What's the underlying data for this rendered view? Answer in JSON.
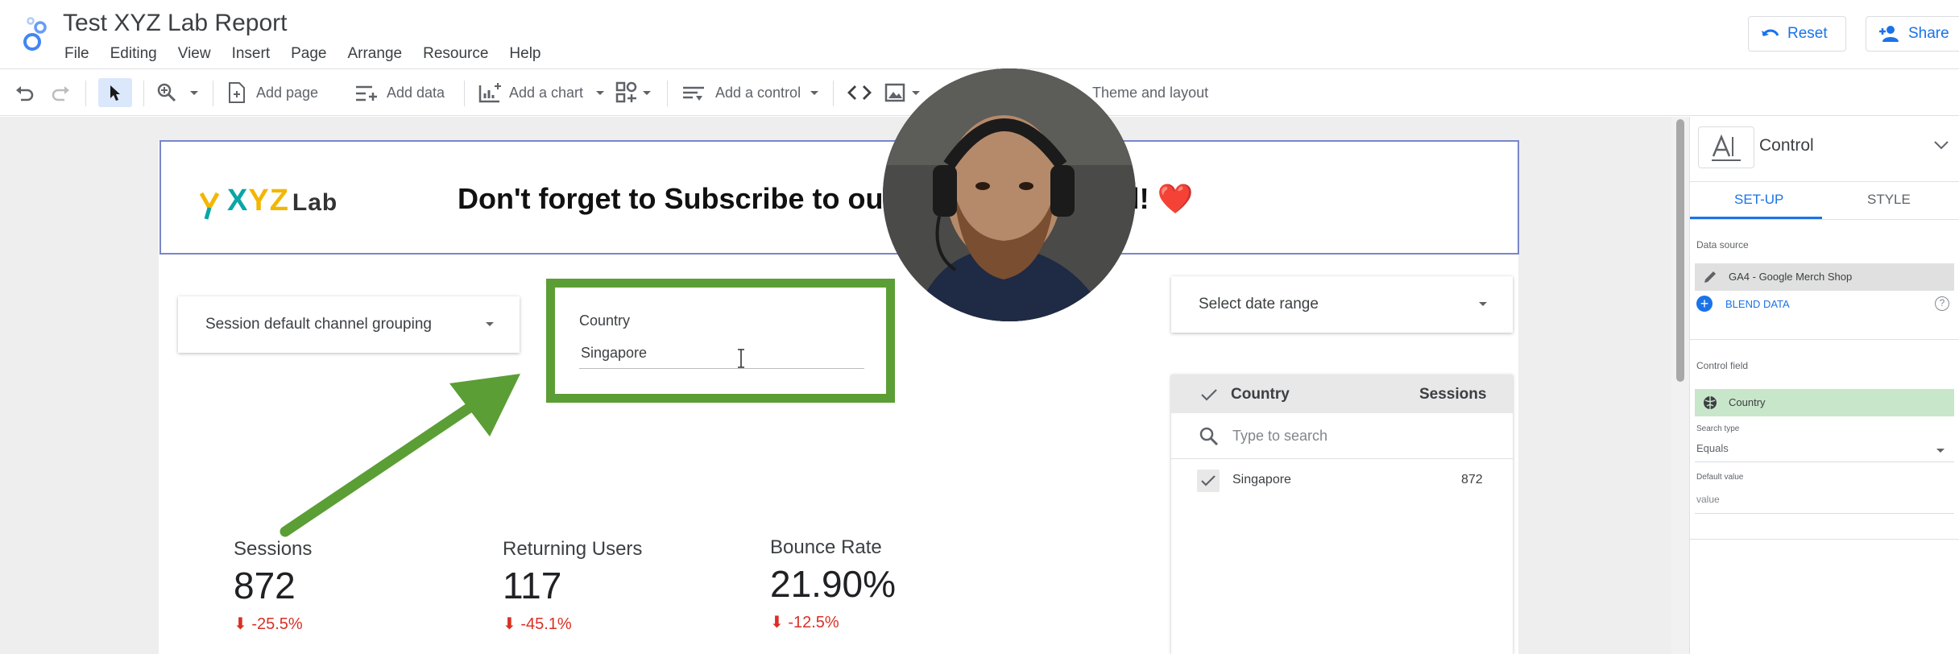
{
  "app": {
    "title": "Test XYZ Lab Report",
    "menu": [
      "File",
      "Editing",
      "View",
      "Insert",
      "Page",
      "Arrange",
      "Resource",
      "Help"
    ],
    "reset_label": "Reset",
    "share_label": "Share"
  },
  "toolbar": {
    "add_page": "Add page",
    "add_data": "Add data",
    "add_chart": "Add a chart",
    "add_control": "Add a control",
    "theme_layout": "Theme and layout"
  },
  "banner": {
    "brand_xyz": "XYZ",
    "brand_lab": "Lab",
    "message": "Don't forget to Subscribe to our YouTube channel! ❤️"
  },
  "controls": {
    "channel_dropdown": "Session default channel grouping",
    "country_label": "Country",
    "country_value": "Singapore",
    "date_range": "Select date range"
  },
  "metrics": [
    {
      "label": "Sessions",
      "value": "872",
      "delta": "-25.5%"
    },
    {
      "label": "Returning Users",
      "value": "117",
      "delta": "-45.1%"
    },
    {
      "label": "Bounce Rate",
      "value": "21.90%",
      "delta": "-12.5%"
    }
  ],
  "country_table": {
    "col_country": "Country",
    "col_sessions": "Sessions",
    "search_placeholder": "Type to search",
    "rows": [
      {
        "country": "Singapore",
        "sessions": "872"
      }
    ]
  },
  "panel": {
    "header": "Control",
    "tab_setup": "SET-UP",
    "tab_style": "STYLE",
    "data_source_label": "Data source",
    "data_source": "GA4 - Google Merch Shop",
    "blend_data": "BLEND DATA",
    "control_field_label": "Control field",
    "control_field": "Country",
    "search_type_label": "Search type",
    "search_type": "Equals",
    "default_value_label": "Default value",
    "default_value": "value"
  },
  "colors": {
    "accent": "#1a73e8",
    "highlight_box": "#5b9e35",
    "arrow": "#5b9e35",
    "negative": "#d93025",
    "field_green": "#c8e6c9"
  }
}
